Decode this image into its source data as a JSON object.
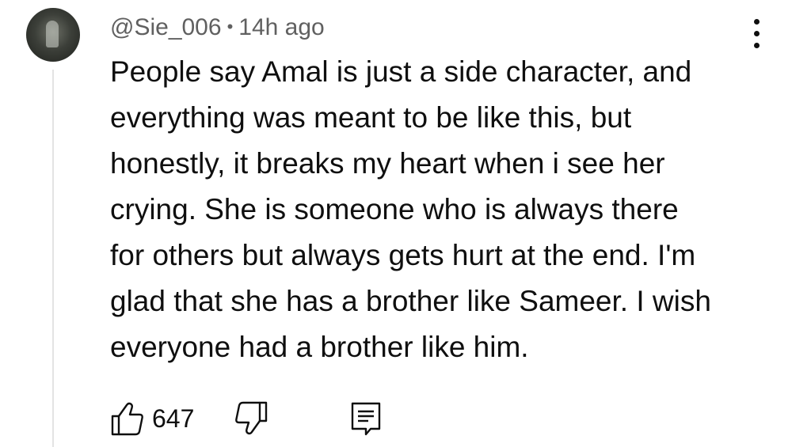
{
  "comment": {
    "author": "@Sie_006",
    "separator": "•",
    "timestamp": "14h ago",
    "text_lines": [
      "People say Amal is just a side character, and",
      "everything was meant to be like this, but",
      "honestly, it breaks my heart when i see her",
      "crying. She is someone who is always there",
      "for others but always gets hurt at the end. I'm",
      "glad that she has a brother like Sameer. I wish",
      "everyone had a brother like him."
    ],
    "like_count": "647"
  },
  "icons": {
    "avatar": "user-avatar",
    "menu": "more-vert-icon",
    "like": "thumbs-up-icon",
    "dislike": "thumbs-down-icon",
    "reply": "reply-comment-icon"
  },
  "colors": {
    "text": "#0f0f0f",
    "meta": "#606060",
    "thread_line": "#e3e3e3"
  }
}
